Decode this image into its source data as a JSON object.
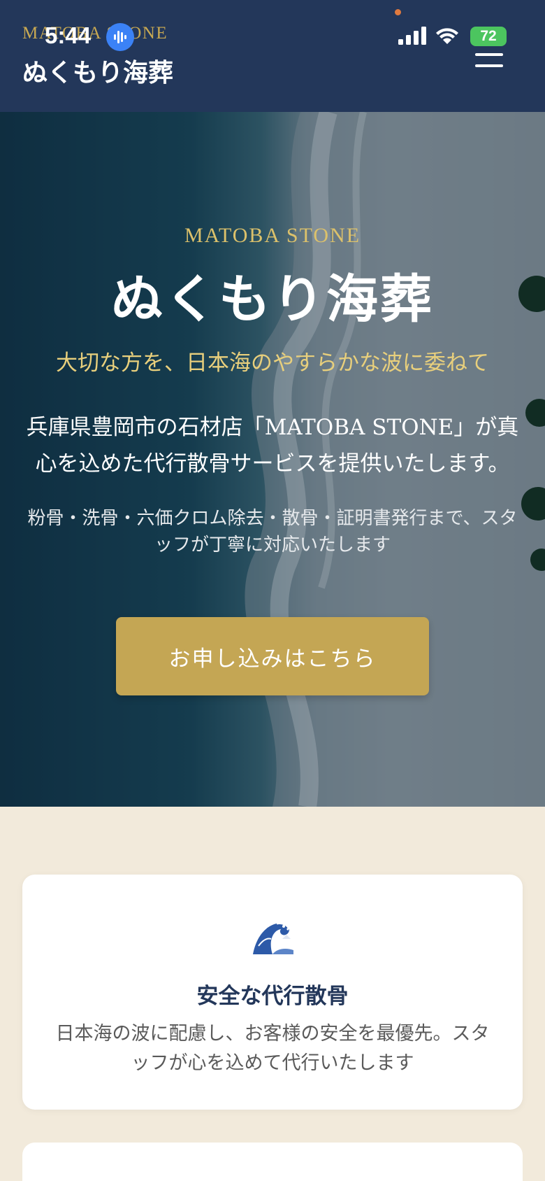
{
  "header": {
    "brand_en": "MATOBA STONE",
    "brand_ja": "ぬくもり海葬",
    "menu_icon": "hamburger-menu-icon"
  },
  "status_bar": {
    "time": "5:44",
    "battery": "72"
  },
  "hero": {
    "label_en": "MATOBA STONE",
    "title": "ぬくもり海葬",
    "tagline": "大切な方を、日本海のやすらかな波に委ねて",
    "description": "兵庫県豊岡市の石材店「MATOBA STONE」が真心を込めた代行散骨サービスを提供いたします。",
    "subtext": "粉骨・洗骨・六価クロム除去・散骨・証明書発行まで、スタッフが丁寧に対応いたします",
    "cta_label": "お申し込みはこちら"
  },
  "features": [
    {
      "icon": "great-wave-icon",
      "title": "安全な代行散骨",
      "description": "日本海の波に配慮し、お客様の安全を最優先。スタッフが心を込めて代行いたします"
    }
  ],
  "colors": {
    "header_bg": "#23375a",
    "gold": "#c4a654",
    "cream_bg": "#f2eadb",
    "card_bg": "#ffffff"
  }
}
